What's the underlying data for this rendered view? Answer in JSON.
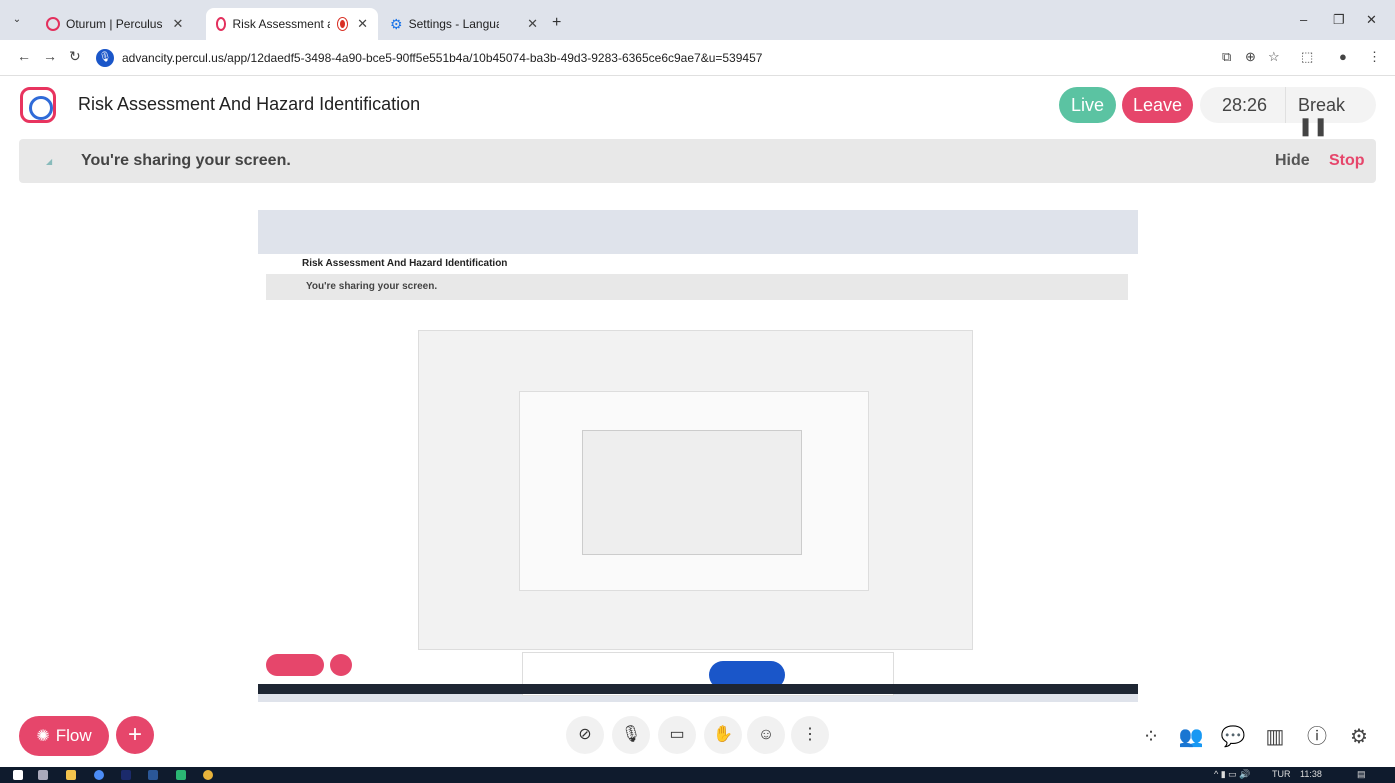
{
  "browser": {
    "tabs": [
      {
        "title": "Oturum | Perculus",
        "active": false
      },
      {
        "title": "Risk Assessment and Hazar",
        "active": true,
        "recording": true
      },
      {
        "title": "Settings - Languages",
        "active": false
      }
    ],
    "url": "advancity.percul.us/app/12daedf5-3498-4a90-bce5-90ff5e551b4a/10b45074-ba3b-49d3-9283-6365ce6c9ae7&u=539457"
  },
  "app": {
    "session_title": "Risk Assessment And Hazard Identification",
    "live_label": "Live",
    "leave_label": "Leave",
    "timer": "28:26",
    "break_label": "Break ❚❚",
    "share_banner": {
      "text": "You're sharing your screen.",
      "hide": "Hide",
      "stop": "Stop"
    },
    "preview": {
      "title": "Risk Assessment And Hazard Identification",
      "banner": "You're sharing your screen."
    },
    "bottom": {
      "flow_label": "Flow",
      "plus": "+"
    }
  },
  "taskbar": {
    "lang": "TUR",
    "time": "11:38"
  },
  "colors": {
    "accent": "#e6466b",
    "live": "#5bc3a2",
    "primary": "#1a56c9"
  }
}
